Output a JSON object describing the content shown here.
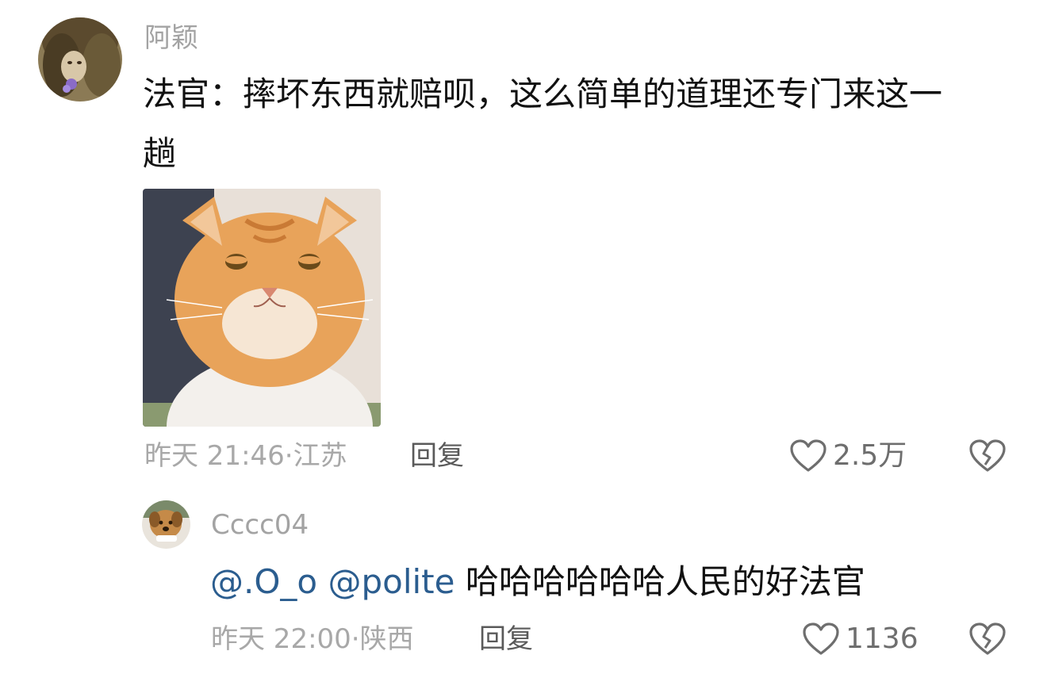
{
  "comments": [
    {
      "username": "阿颖",
      "text_line1": "法官：摔坏东西就赔呗，这么简单的道理还专门来这一",
      "text_line2": "趟",
      "time": "昨天 21:46",
      "location": "江苏",
      "reply_label": "回复",
      "like_count": "2.5万",
      "avatar_icon": "woman-avatar",
      "sticker_icon": "orange-cat-sticker"
    },
    {
      "username": "Cccc04",
      "mentions": [
        "@.O_o",
        "@polite"
      ],
      "text": "哈哈哈哈哈哈人民的好法官",
      "time": "昨天 22:00",
      "location": "陕西",
      "reply_label": "回复",
      "like_count": "1136",
      "avatar_icon": "dog-avatar"
    }
  ],
  "icons": {
    "like": "heart-outline-icon",
    "dislike": "broken-heart-icon"
  },
  "colors": {
    "mention": "#2b5d8f",
    "meta": "#a8a8a8",
    "text": "#111111"
  }
}
